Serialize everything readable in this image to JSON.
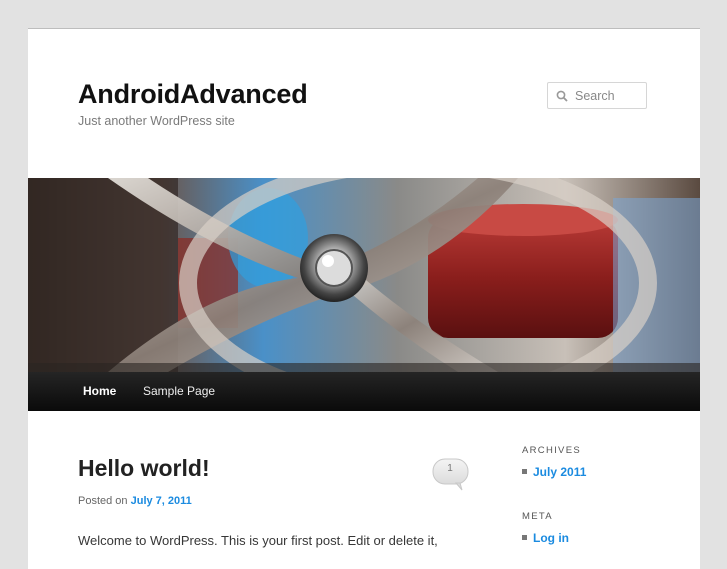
{
  "site": {
    "title": "AndroidAdvanced",
    "description": "Just another WordPress site"
  },
  "search": {
    "placeholder": "Search"
  },
  "nav": {
    "items": [
      {
        "label": "Home"
      },
      {
        "label": "Sample Page"
      }
    ]
  },
  "post": {
    "title": "Hello world!",
    "comment_count": "1",
    "posted_on_prefix": "Posted on",
    "date": "July 7, 2011",
    "excerpt": "Welcome to WordPress. This is your first post. Edit or delete it,"
  },
  "sidebar": {
    "archives": {
      "title": "ARCHIVES",
      "items": [
        {
          "label": "July 2011"
        }
      ]
    },
    "meta": {
      "title": "META",
      "items": [
        {
          "label": "Log in"
        }
      ]
    }
  },
  "colors": {
    "background": "#e2e2e2",
    "link": "#1b8be0",
    "nav": "#1a1a1a"
  }
}
